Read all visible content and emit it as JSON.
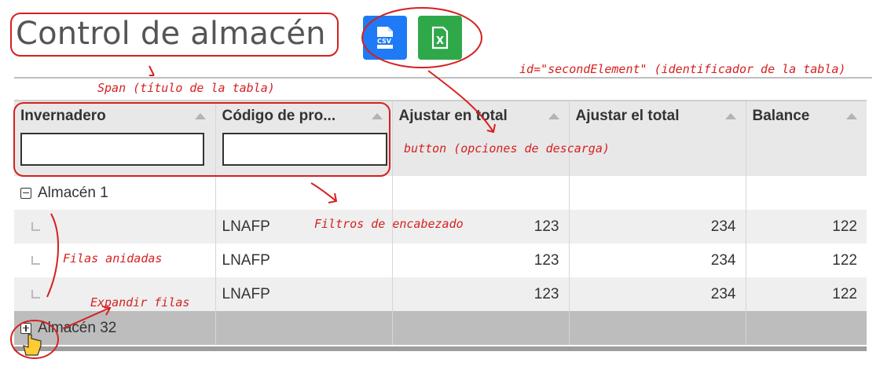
{
  "page": {
    "title": "Control de almacén"
  },
  "download": {
    "csv_label": "CSV",
    "xls_label": "X"
  },
  "table": {
    "columns": [
      {
        "label": "Invernadero",
        "filter": true
      },
      {
        "label": "Código de pro...",
        "filter": true
      },
      {
        "label": "Ajustar en total",
        "filter": false
      },
      {
        "label": "Ajustar el total",
        "filter": false
      },
      {
        "label": "Balance",
        "filter": false
      }
    ],
    "groups": [
      {
        "name": "Almacén 1",
        "expanded": true,
        "rows": [
          {
            "code": "LNAFP",
            "a": "123",
            "b": "234",
            "c": "122"
          },
          {
            "code": "LNAFP",
            "a": "123",
            "b": "234",
            "c": "122"
          },
          {
            "code": "LNAFP",
            "a": "123",
            "b": "234",
            "c": "122"
          }
        ]
      },
      {
        "name": "Almacén 32",
        "expanded": false,
        "rows": []
      }
    ]
  },
  "annotations": {
    "id_note": "id=\"secondElement\" (identificador de la tabla)",
    "span_note": "Span (título de la tabla)",
    "button_note": "button (opciones de descarga)",
    "filters_note": "Filtros de encabezado",
    "nested_note": "Filas anidadas",
    "expand_note": "Expandir filas",
    "color": "#d62020"
  }
}
